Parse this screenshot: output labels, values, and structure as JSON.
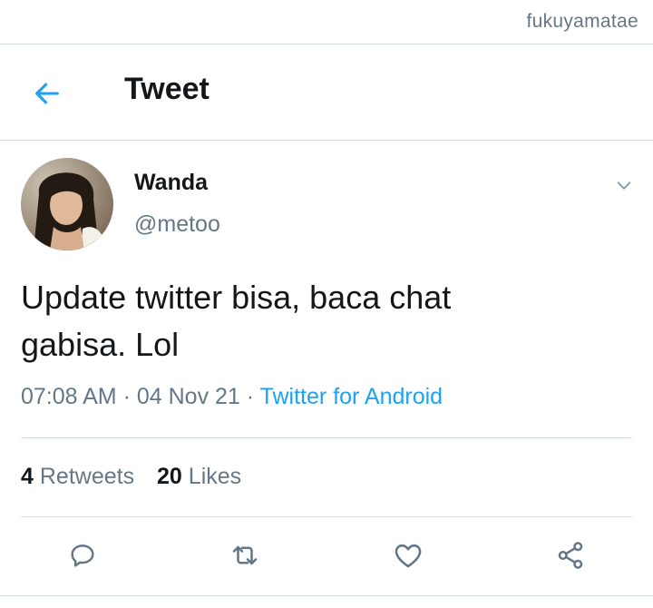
{
  "watermark": "fukuyamatae",
  "header": {
    "title": "Tweet",
    "back_icon": "arrow-left-icon"
  },
  "tweet": {
    "author": {
      "name": "Wanda",
      "handle": "@metoo"
    },
    "text": "Update twitter bisa, baca chat\ngabisa. Lol",
    "time": "07:08 AM",
    "separator": " · ",
    "date": "04 Nov 21",
    "source": "Twitter for Android",
    "stats": {
      "retweets_count": "4",
      "retweets_label": "Retweets",
      "likes_count": "20",
      "likes_label": "Likes"
    }
  },
  "actions": [
    "reply-icon",
    "retweet-icon",
    "like-icon",
    "share-icon"
  ],
  "colors": {
    "accent": "#1da1f2",
    "secondary_text": "#657786",
    "divider": "#d8dde1"
  }
}
